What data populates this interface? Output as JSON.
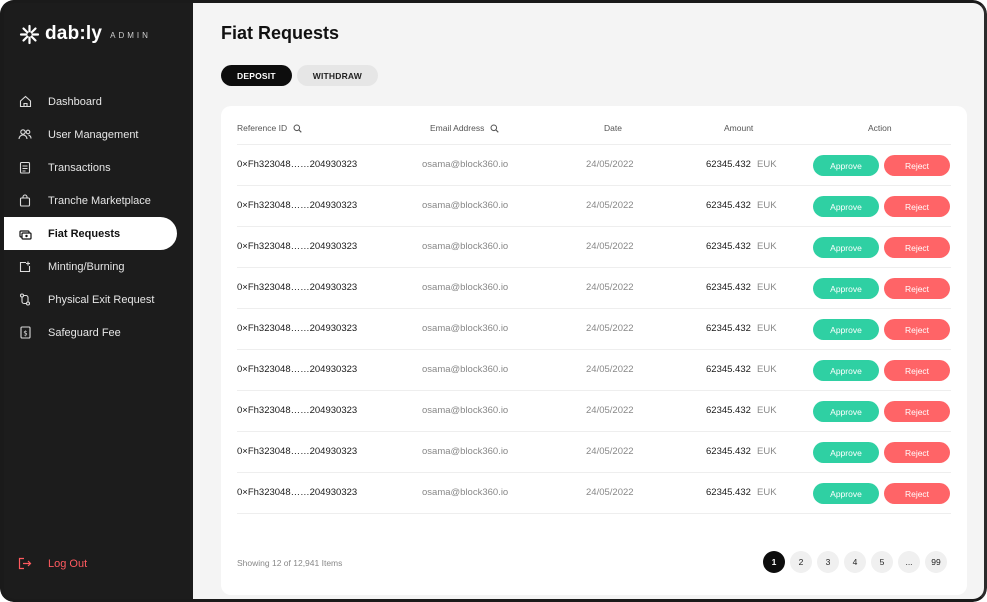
{
  "brand": {
    "name": "dab:ly",
    "suffix": "ADMIN"
  },
  "sidebar": {
    "items": [
      {
        "label": "Dashboard",
        "icon": "home-icon"
      },
      {
        "label": "User Management",
        "icon": "users-icon"
      },
      {
        "label": "Transactions",
        "icon": "clipboard-icon"
      },
      {
        "label": "Tranche Marketplace",
        "icon": "bag-icon"
      },
      {
        "label": "Fiat Requests",
        "icon": "cash-icon",
        "active": true
      },
      {
        "label": "Minting/Burning",
        "icon": "mint-icon"
      },
      {
        "label": "Physical Exit Request",
        "icon": "route-icon"
      },
      {
        "label": "Safeguard Fee",
        "icon": "fee-icon"
      }
    ],
    "logout": "Log Out"
  },
  "page": {
    "title": "Fiat Requests",
    "tabs": [
      "DEPOSIT",
      "WITHDRAW"
    ],
    "active_tab": "DEPOSIT"
  },
  "table": {
    "columns": {
      "reference": "Reference ID",
      "email": "Email Address",
      "date": "Date",
      "amount": "Amount",
      "action": "Action"
    },
    "approve_label": "Approve",
    "reject_label": "Reject",
    "rows": [
      {
        "ref": "0×Fh323048……204930323",
        "email": "osama@block360.io",
        "date": "24/05/2022",
        "amount": "62345.432",
        "unit": "EUK"
      },
      {
        "ref": "0×Fh323048……204930323",
        "email": "osama@block360.io",
        "date": "24/05/2022",
        "amount": "62345.432",
        "unit": "EUK"
      },
      {
        "ref": "0×Fh323048……204930323",
        "email": "osama@block360.io",
        "date": "24/05/2022",
        "amount": "62345.432",
        "unit": "EUK"
      },
      {
        "ref": "0×Fh323048……204930323",
        "email": "osama@block360.io",
        "date": "24/05/2022",
        "amount": "62345.432",
        "unit": "EUK"
      },
      {
        "ref": "0×Fh323048……204930323",
        "email": "osama@block360.io",
        "date": "24/05/2022",
        "amount": "62345.432",
        "unit": "EUK"
      },
      {
        "ref": "0×Fh323048……204930323",
        "email": "osama@block360.io",
        "date": "24/05/2022",
        "amount": "62345.432",
        "unit": "EUK"
      },
      {
        "ref": "0×Fh323048……204930323",
        "email": "osama@block360.io",
        "date": "24/05/2022",
        "amount": "62345.432",
        "unit": "EUK"
      },
      {
        "ref": "0×Fh323048……204930323",
        "email": "osama@block360.io",
        "date": "24/05/2022",
        "amount": "62345.432",
        "unit": "EUK"
      },
      {
        "ref": "0×Fh323048……204930323",
        "email": "osama@block360.io",
        "date": "24/05/2022",
        "amount": "62345.432",
        "unit": "EUK"
      }
    ]
  },
  "footer": {
    "showing": "Showing 12 of 12,941 Items",
    "pages": [
      "1",
      "2",
      "3",
      "4",
      "5",
      "...",
      "99"
    ],
    "current_page": "1"
  },
  "colors": {
    "sidebar": "#1c1c1c",
    "approve": "#2fd0a3",
    "reject": "#ff6467",
    "logout": "#ff5a5f"
  }
}
